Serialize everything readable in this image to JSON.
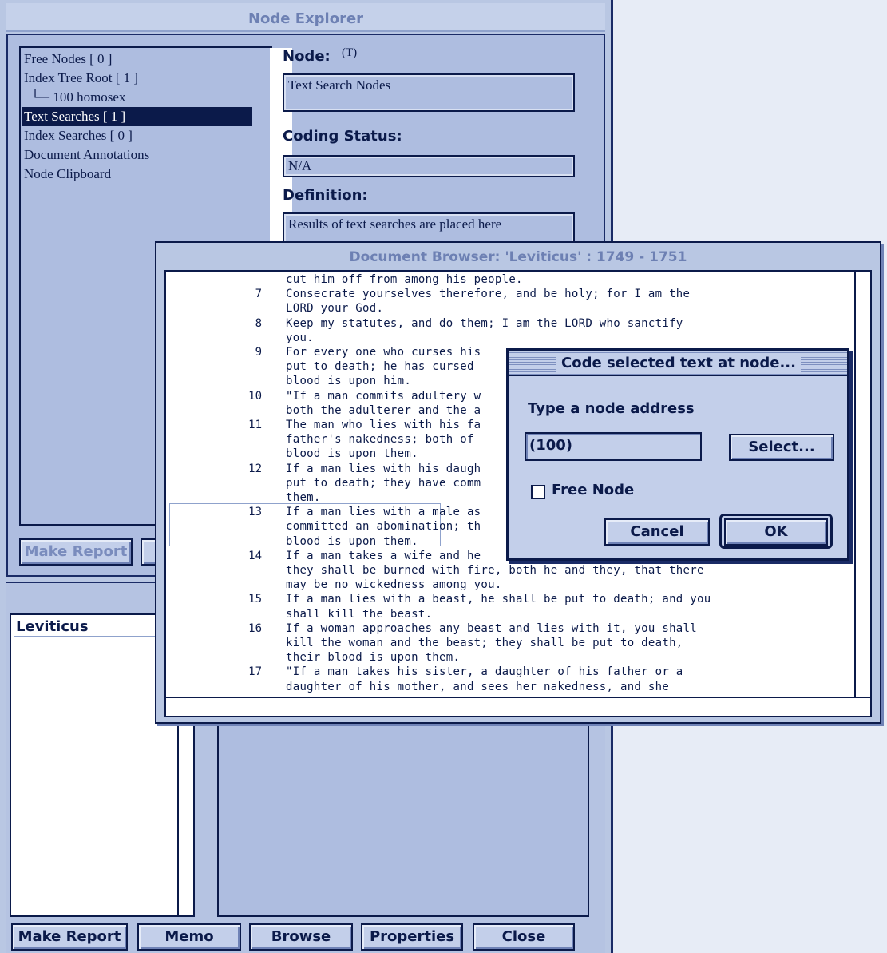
{
  "node_explorer": {
    "title": "Node Explorer",
    "tree": [
      "Free Nodes [ 0 ]",
      "Index Tree Root [ 1 ]",
      "└─ 100   homosex",
      "Text Searches [ 1 ]",
      "Index Searches [ 0 ]",
      "Document Annotations",
      "Node Clipboard"
    ],
    "node_label": "Node:",
    "node_type": "(T)",
    "node_value": "Text Search Nodes",
    "coding_status_label": "Coding Status:",
    "coding_status_value": "N/A",
    "definition_label": "Definition:",
    "definition_value": "Results of text searches are placed here",
    "make_report_label": "Make Report"
  },
  "lower_panel": {
    "document": "Leviticus",
    "buttons": [
      "Make Report",
      "Memo",
      "Browse",
      "Properties",
      "Close"
    ]
  },
  "document_browser": {
    "title": "Document Browser: 'Leviticus' : 1749 - 1751",
    "lines": [
      {
        "n": "",
        "t": "cut him off from among his people."
      },
      {
        "n": "7",
        "t": "Consecrate yourselves therefore, and be holy; for I am the"
      },
      {
        "n": "",
        "t": "LORD your God."
      },
      {
        "n": "8",
        "t": "Keep my statutes, and do them; I am the LORD who sanctify"
      },
      {
        "n": "",
        "t": "you."
      },
      {
        "n": "9",
        "t": "For every one who curses his"
      },
      {
        "n": "",
        "t": "put to death; he has cursed"
      },
      {
        "n": "",
        "t": "blood is upon him."
      },
      {
        "n": "10",
        "t": "\"If a man commits adultery w"
      },
      {
        "n": "",
        "t": "both the adulterer and the a"
      },
      {
        "n": "11",
        "t": "The man who lies with his fa"
      },
      {
        "n": "",
        "t": "father's nakedness; both of"
      },
      {
        "n": "",
        "t": "blood is upon them."
      },
      {
        "n": "12",
        "t": "If a man lies with his daugh"
      },
      {
        "n": "",
        "t": "put to death; they have comm"
      },
      {
        "n": "",
        "t": "them."
      },
      {
        "n": "13",
        "t": "If a man lies with a male as"
      },
      {
        "n": "",
        "t": "committed an abomination; th"
      },
      {
        "n": "",
        "t": "blood is upon them."
      },
      {
        "n": "14",
        "t": "If a man takes a wife and he"
      },
      {
        "n": "",
        "t": "they shall be burned with fire, both he and they, that there"
      },
      {
        "n": "",
        "t": "may be no wickedness among you."
      },
      {
        "n": "15",
        "t": "If a man lies with a beast, he shall be put to death; and you"
      },
      {
        "n": "",
        "t": "shall kill the beast."
      },
      {
        "n": "16",
        "t": "If a woman approaches any beast and lies with it, you shall"
      },
      {
        "n": "",
        "t": "kill the woman and the beast; they shall be put to death,"
      },
      {
        "n": "",
        "t": "their blood is upon them."
      },
      {
        "n": "17",
        "t": "\"If a man takes his sister, a daughter of his father or a"
      },
      {
        "n": "",
        "t": "daughter of his mother, and sees her nakedness, and she"
      }
    ]
  },
  "dialog": {
    "title": "Code selected text at node...",
    "prompt": "Type a node address",
    "input_value": "(100)",
    "select_label": "Select...",
    "checkbox_label": "Free Node",
    "cancel_label": "Cancel",
    "ok_label": "OK"
  }
}
